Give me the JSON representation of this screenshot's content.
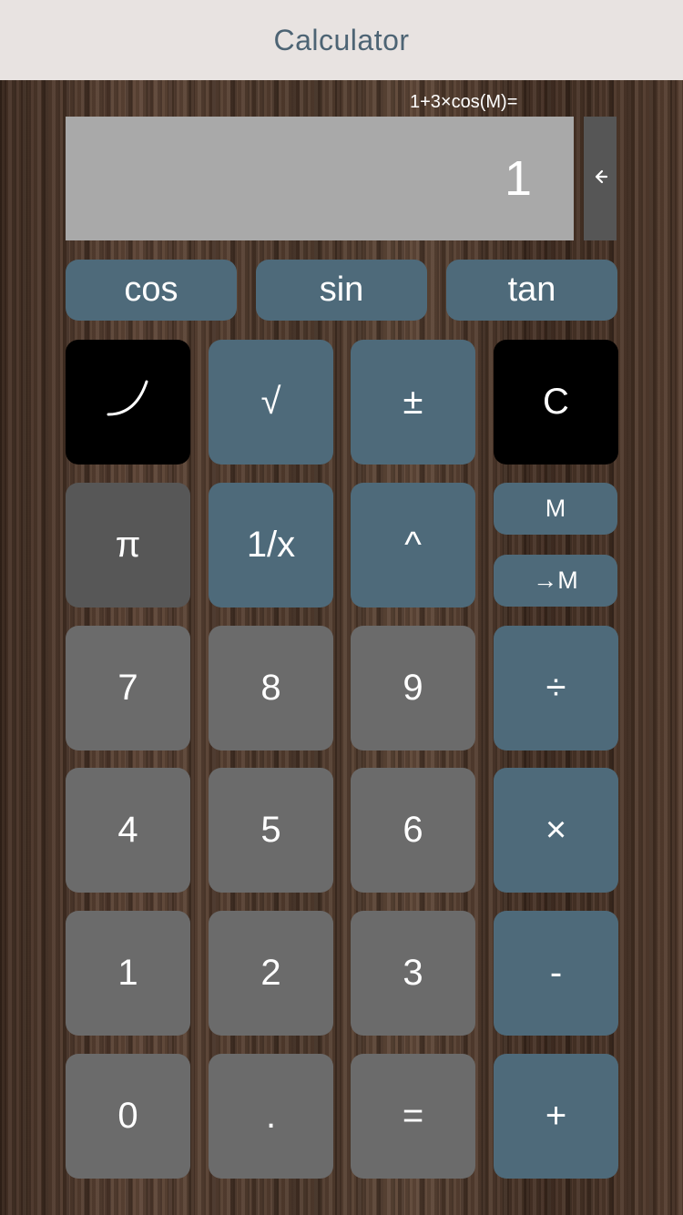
{
  "nav": {
    "title": "Calculator"
  },
  "expression": "1+3×cos(M)=",
  "display": {
    "value": "1"
  },
  "icons": {
    "backspace": "arrow-left-icon",
    "curve": "curve-icon"
  },
  "colors": {
    "nav_bg": "#e8e3e1",
    "nav_title": "#4d6474",
    "display_bg": "#a9a9a9",
    "blue_key": "#4e6a7a",
    "gray_key": "#6b6b6b",
    "dark_key": "#575757",
    "black_key": "#000000"
  },
  "trig": {
    "cos": "cos",
    "sin": "sin",
    "tan": "tan"
  },
  "keys": {
    "sqrt": "√",
    "plus_minus": "±",
    "clear": "C",
    "pi": "π",
    "reciprocal": "1/x",
    "power": "^",
    "memory_recall": "M",
    "memory_store": "→M",
    "seven": "7",
    "eight": "8",
    "nine": "9",
    "divide": "÷",
    "four": "4",
    "five": "5",
    "six": "6",
    "multiply": "×",
    "one": "1",
    "two": "2",
    "three": "3",
    "minus": "-",
    "zero": "0",
    "decimal": ".",
    "equals": "=",
    "plus": "+"
  }
}
